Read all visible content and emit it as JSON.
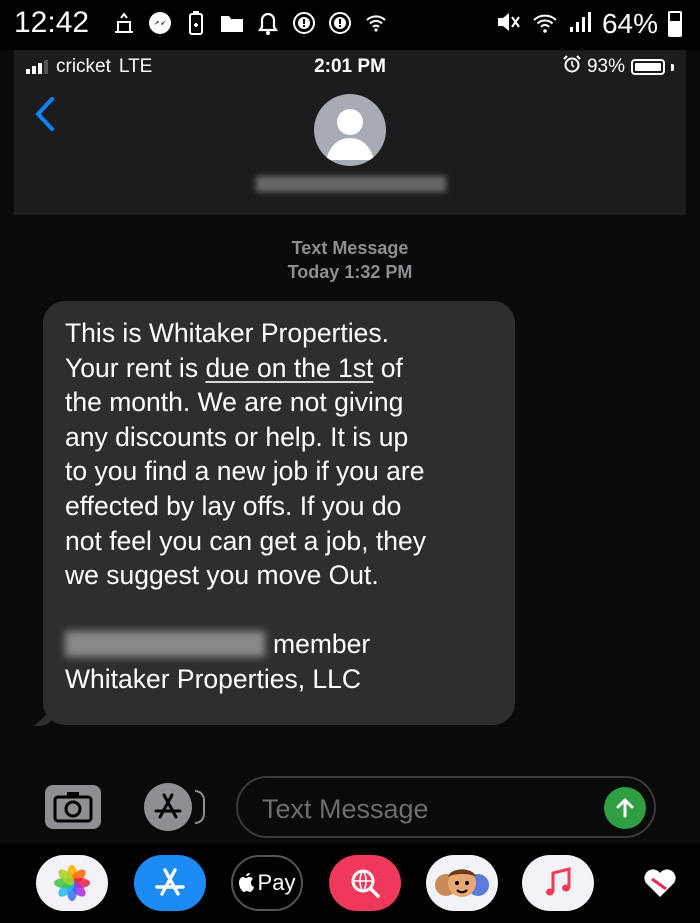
{
  "android_status": {
    "time": "12:42",
    "battery": "64%",
    "icons": [
      "voicemail-icon",
      "messenger-icon",
      "battery-saver-icon",
      "folder-icon",
      "bell-icon",
      "alert-icon",
      "alert-icon",
      "wifi-icon",
      "mute-icon",
      "wifi-icon",
      "signal-icon"
    ]
  },
  "ios_status": {
    "carrier": "cricket",
    "network": "LTE",
    "time": "2:01 PM",
    "battery": "93%"
  },
  "conversation": {
    "service": "Text Message",
    "timestamp": "Today 1:32 PM"
  },
  "message": {
    "lines": [
      "This is Whitaker Properties.",
      "Your rent is ",
      "due on the 1st",
      " of",
      "the month.  We are not giving",
      "any discounts or help.  It is up",
      "to you find a new job if you are",
      "effected by lay offs. If you do",
      "not feel you can get a job, they",
      "we suggest you move Out."
    ],
    "signature_role": "member",
    "signature_company": "Whitaker Properties, LLC"
  },
  "compose": {
    "placeholder": "Text Message"
  },
  "app_tray": {
    "apple_pay_label": "Pay"
  },
  "colors": {
    "bubble": "#2e2e30",
    "send": "#2ea043",
    "back_chevron": "#0a84ff"
  }
}
